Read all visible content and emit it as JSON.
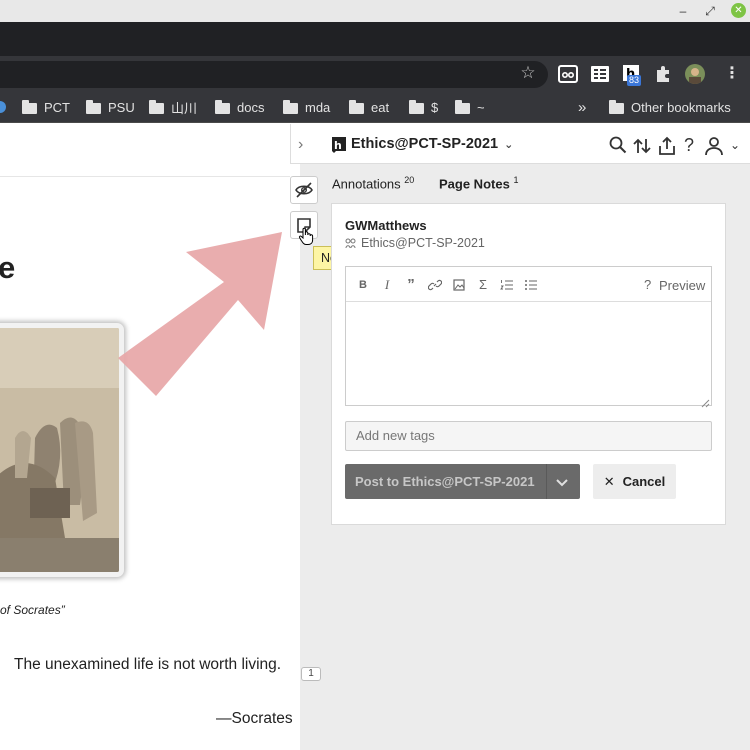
{
  "browser": {
    "bookmarks": [
      {
        "label": "PCT"
      },
      {
        "label": "PSU"
      },
      {
        "label": "山川"
      },
      {
        "label": "docs"
      },
      {
        "label": "mda"
      },
      {
        "label": "eat"
      },
      {
        "label": "$"
      },
      {
        "label": "~"
      }
    ],
    "overflow_label": "»",
    "other_bookmarks": "Other bookmarks",
    "extension_badge": "83"
  },
  "page": {
    "heading_fragment": "e",
    "caption": "of Socrates”",
    "quote": "The unexamined life is not worth living.",
    "attribution": "—Socrates",
    "annotation_count": "1"
  },
  "tooltip": "New page note",
  "sidebar": {
    "group_name": "Ethics@PCT-SP-2021",
    "tabs": {
      "annotations_label": "Annotations",
      "annotations_count": "20",
      "page_notes_label": "Page Notes",
      "page_notes_count": "1"
    },
    "card": {
      "user": "GWMatthews",
      "group": "Ethics@PCT-SP-2021",
      "preview_label": "Preview",
      "help_label": "?",
      "tags_placeholder": "Add new tags",
      "post_label": "Post to Ethics@PCT-SP-2021",
      "cancel_label": "Cancel"
    }
  },
  "colors": {
    "arrow": "#e7a6a7",
    "tooltip_bg": "#fdf5a5",
    "post_button": "#6a6a6a",
    "browser_dark": "#35363a"
  }
}
